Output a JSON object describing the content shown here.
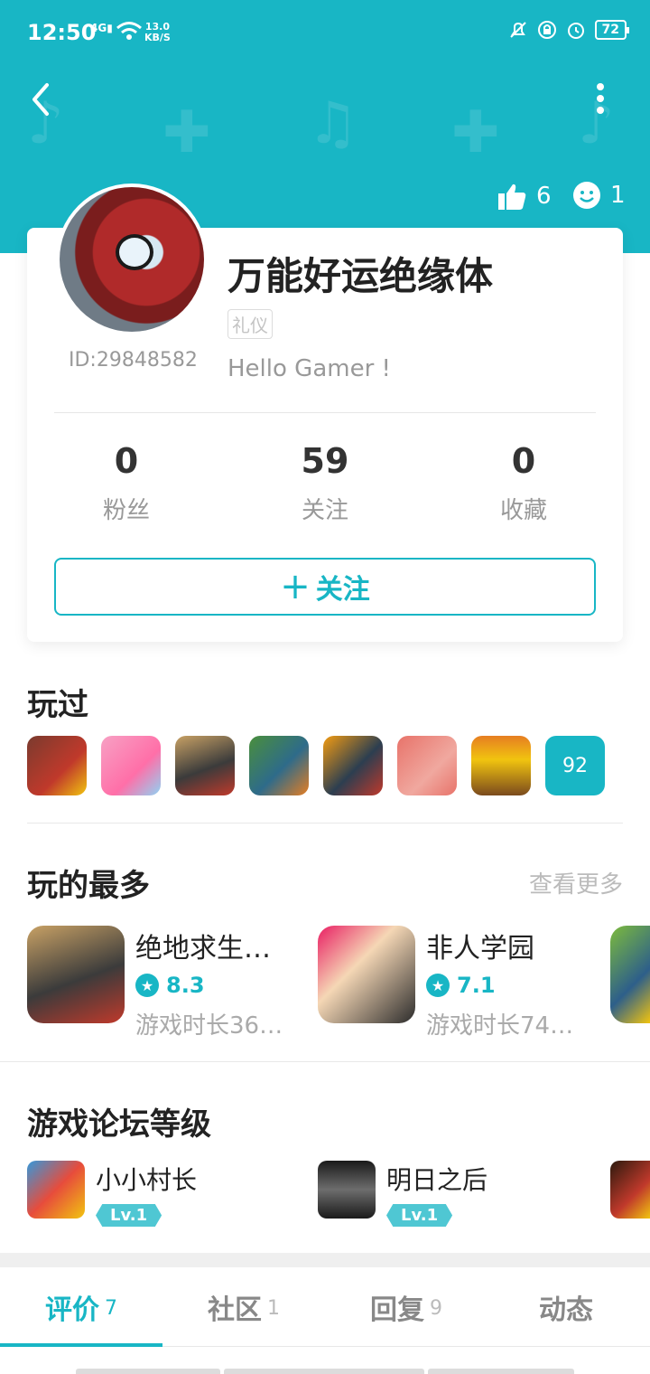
{
  "colors": {
    "accent": "#18b6c5"
  },
  "status_bar": {
    "time": "12:50",
    "network": "4G",
    "speed": "13.0",
    "speed_unit": "KB/S",
    "battery": "72"
  },
  "stats_header": {
    "likes": "6",
    "smiles": "1"
  },
  "profile": {
    "name": "万能好运绝缘体",
    "tag": "礼仪",
    "id": "ID:29848582",
    "bio": "Hello Gamer !"
  },
  "stats": [
    {
      "value": "0",
      "label": "粉丝"
    },
    {
      "value": "59",
      "label": "关注"
    },
    {
      "value": "0",
      "label": "收藏"
    }
  ],
  "follow_button": {
    "plus": "+",
    "label": "关注"
  },
  "played": {
    "title": "玩过",
    "more_count": "92"
  },
  "most_played": {
    "title": "玩的最多",
    "see_more": "查看更多",
    "items": [
      {
        "name": "绝地求生：…",
        "score": "8.3",
        "time": "游戏时长363…"
      },
      {
        "name": "非人学园",
        "score": "7.1",
        "time": "游戏时长74…"
      }
    ]
  },
  "forum_levels": {
    "title": "游戏论坛等级",
    "items": [
      {
        "name": "小小村长",
        "level": "Lv.1"
      },
      {
        "name": "明日之后",
        "level": "Lv.1"
      }
    ]
  },
  "tabs": [
    {
      "label": "评价",
      "count": "7"
    },
    {
      "label": "社区",
      "count": "1"
    },
    {
      "label": "回复",
      "count": "9"
    },
    {
      "label": "动态",
      "count": ""
    }
  ]
}
